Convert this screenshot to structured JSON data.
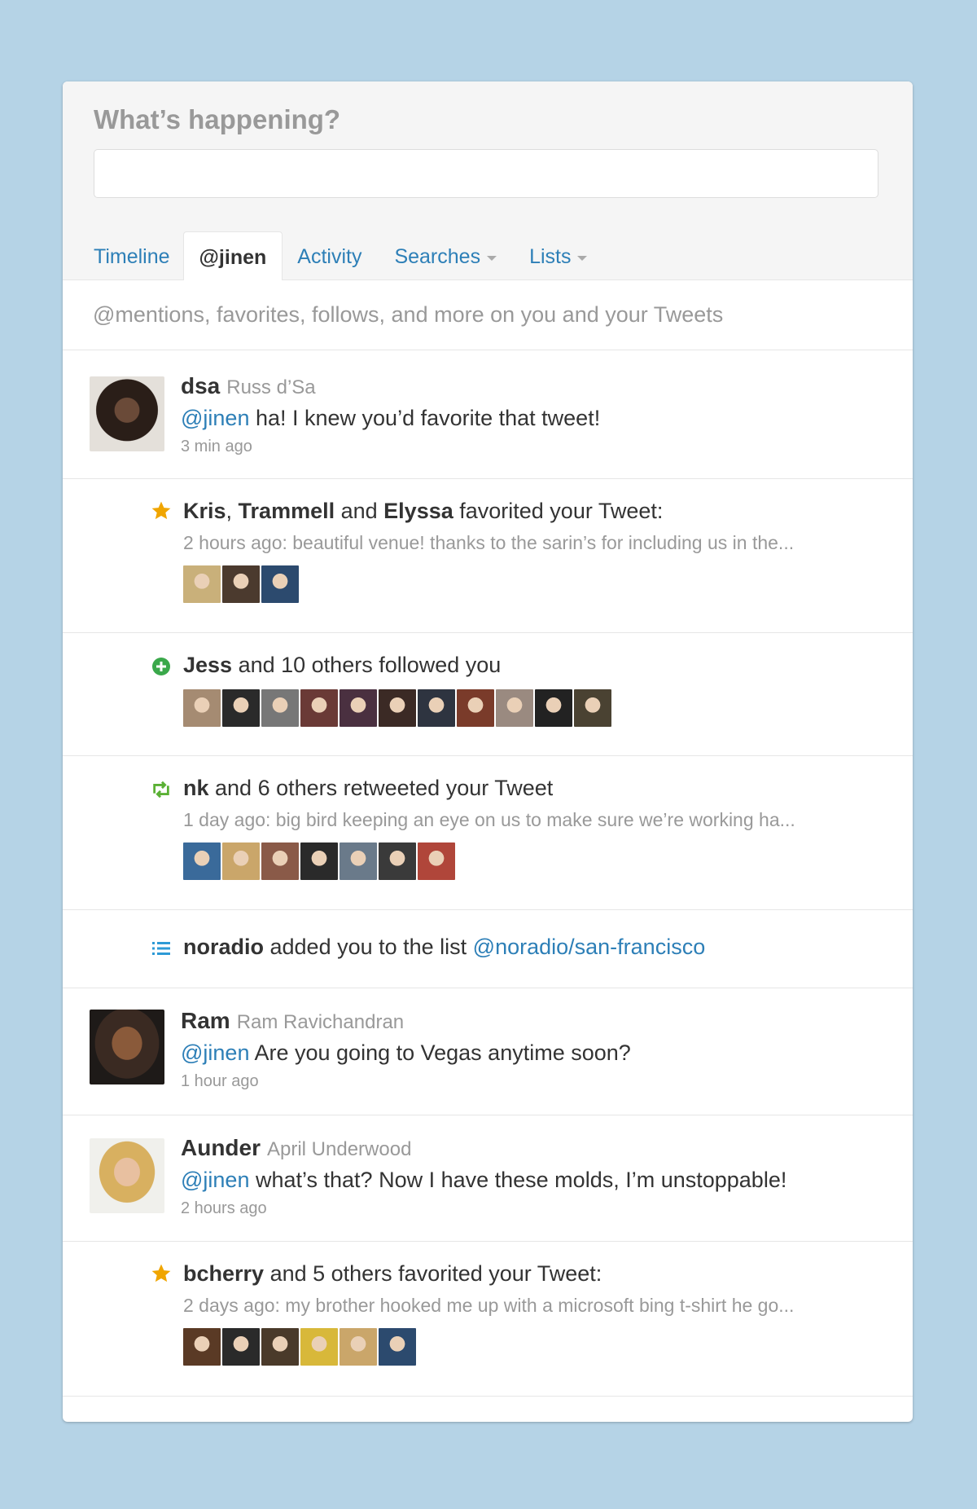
{
  "header": {
    "title": "What’s happening?"
  },
  "tabs": [
    {
      "label": "Timeline"
    },
    {
      "label": "@jinen"
    },
    {
      "label": "Activity"
    },
    {
      "label": "Searches"
    },
    {
      "label": "Lists"
    }
  ],
  "subheader": "@mentions, favorites, follows, and more on you and your Tweets",
  "items": {
    "dsa": {
      "screen_name": "dsa",
      "full_name": "Russ d’Sa",
      "mention": "@jinen",
      "text": " ha! I knew you’d favorite that tweet!",
      "time": "3 min ago"
    },
    "fav1": {
      "name1": "Kris",
      "sep1": ", ",
      "name2": "Trammell",
      "and": " and ",
      "name3": "Elyssa",
      "action": " favorited your Tweet:",
      "snippet": "2 hours ago: beautiful venue! thanks to the sarin’s for including us in the...",
      "avatar_colors": [
        "#c9b07a",
        "#4b3a2e",
        "#2c4a6e"
      ]
    },
    "follow": {
      "name": "Jess",
      "action": " and 10 others followed you",
      "avatar_colors": [
        "#a58b72",
        "#2a2a2a",
        "#777777",
        "#6a3a36",
        "#4a3040",
        "#3b2a25",
        "#2e3440",
        "#7a3b2a",
        "#9a8a80",
        "#222222",
        "#4a4232"
      ]
    },
    "retweet": {
      "name": "nk",
      "action": " and 6 others retweeted your Tweet",
      "snippet": "1 day ago: big bird keeping an eye on us to make sure we’re working ha...",
      "avatar_colors": [
        "#3a6a9a",
        "#caa66a",
        "#8a5a48",
        "#2a2a2a",
        "#6a7a8a",
        "#3a3a3a",
        "#b0463a"
      ]
    },
    "list": {
      "name": "noradio",
      "action": " added you to the list ",
      "list_name": "@noradio/san-francisco"
    },
    "ram": {
      "screen_name": "Ram",
      "full_name": "Ram Ravichandran",
      "mention": "@jinen",
      "text": " Are you going to Vegas anytime soon?",
      "time": "1 hour ago"
    },
    "aunder": {
      "screen_name": "Aunder",
      "full_name": "April Underwood",
      "mention": "@jinen",
      "text": " what’s that? Now I have these molds, I’m unstoppable!",
      "time": "2 hours ago"
    },
    "fav2": {
      "name": "bcherry",
      "action": " and 5 others favorited your Tweet:",
      "snippet": "2 days ago: my brother hooked me up with a microsoft bing t-shirt he go...",
      "avatar_colors": [
        "#5a3a25",
        "#2a2a2a",
        "#4a3a2a",
        "#d8b83a",
        "#caa66a",
        "#2c4a6e"
      ]
    }
  },
  "colors": {
    "background": "#b5d3e6",
    "link": "#2d7fb7",
    "star": "#f0a500",
    "follow": "#3aa84a",
    "retweet": "#5ab034"
  }
}
